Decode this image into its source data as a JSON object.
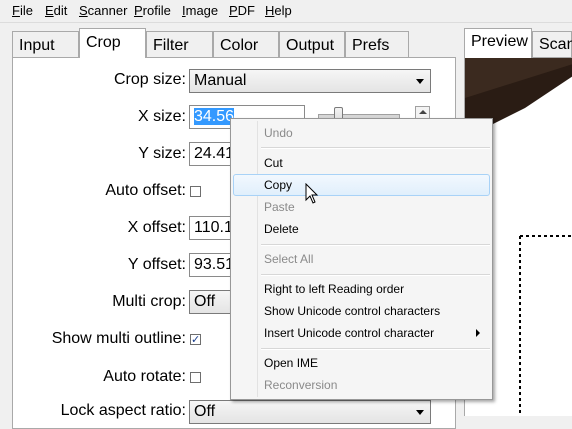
{
  "menubar": {
    "items": [
      {
        "ul": "F",
        "rest": "ile"
      },
      {
        "ul": "E",
        "rest": "dit"
      },
      {
        "ul": "S",
        "rest": "canner"
      },
      {
        "ul": "P",
        "rest": "rofile"
      },
      {
        "ul": "I",
        "rest": "mage"
      },
      {
        "ul": "P",
        "rest": "DF"
      },
      {
        "ul": "H",
        "rest": "elp"
      }
    ]
  },
  "left_tabs": [
    "Input",
    "Crop",
    "Filter",
    "Color",
    "Output",
    "Prefs"
  ],
  "right_tabs": [
    "Preview",
    "Scan"
  ],
  "crop": {
    "crop_size_label": "Crop size:",
    "crop_size_value": "Manual",
    "x_size_label": "X size:",
    "x_size_value": "34.56",
    "y_size_label": "Y size:",
    "y_size_value": "24.41",
    "auto_offset_label": "Auto offset:",
    "x_offset_label": "X offset:",
    "x_offset_value": "110.1",
    "y_offset_label": "Y offset:",
    "y_offset_value": "93.51",
    "multi_crop_label": "Multi crop:",
    "multi_crop_value": "Off",
    "show_multi_outline_label": "Show multi outline:",
    "show_multi_outline_checked": true,
    "auto_rotate_label": "Auto rotate:",
    "lock_aspect_label": "Lock aspect ratio:",
    "lock_aspect_value": "Off"
  },
  "context_menu": {
    "undo": "Undo",
    "cut": "Cut",
    "copy": "Copy",
    "paste": "Paste",
    "delete": "Delete",
    "select_all": "Select All",
    "rtl": "Right to left Reading order",
    "show_unicode": "Show Unicode control characters",
    "insert_unicode": "Insert Unicode control character",
    "open_ime": "Open IME",
    "reconversion": "Reconversion"
  },
  "colors": {
    "selection": "#3399ff",
    "menu_hover_border": "#a8d2f7"
  }
}
